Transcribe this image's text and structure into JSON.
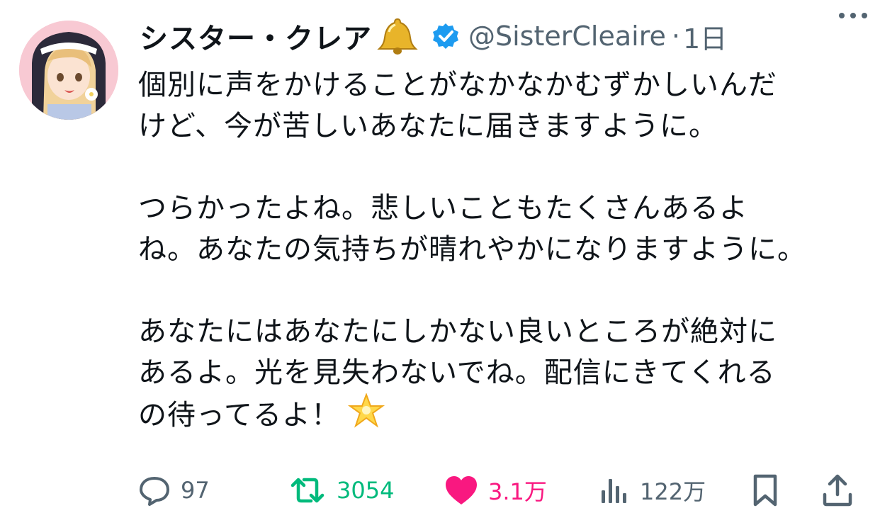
{
  "tweet": {
    "author_name": "シスター・クレア",
    "handle": "@SisterCleaire",
    "separator": "·",
    "time": "1日",
    "paragraphs": [
      [
        "個別に声をかけることがなかなかむずかしいんだ",
        "けど、今が苦しいあなたに届きますように。"
      ],
      [
        "つらかったよね。悲しいこともたくさんあるよ",
        "ね。あなたの気持ちが晴れやかになりますように。"
      ],
      [
        "あなたにはあなたにしかない良いところが絶対に",
        "あるよ。光を見失わないでね。配信にきてくれる",
        "の待ってるよ！"
      ]
    ]
  },
  "actions": {
    "replies": "97",
    "retweets": "3054",
    "likes": "3.1万",
    "views": "122万"
  },
  "icons": {
    "name_emoji": "bell-emoji",
    "badge": "verified-badge",
    "body_emoji": "glowing-star-emoji",
    "reply": "speech-bubble-icon",
    "retweet": "retweet-icon",
    "like": "heart-icon",
    "views": "bar-chart-icon",
    "bookmark": "bookmark-icon",
    "share": "share-icon",
    "more": "more-icon"
  },
  "colors": {
    "text": "#0f1419",
    "muted": "#536471",
    "verified": "#1d9bf0",
    "retweet": "#00ba7c",
    "like": "#f91880"
  }
}
